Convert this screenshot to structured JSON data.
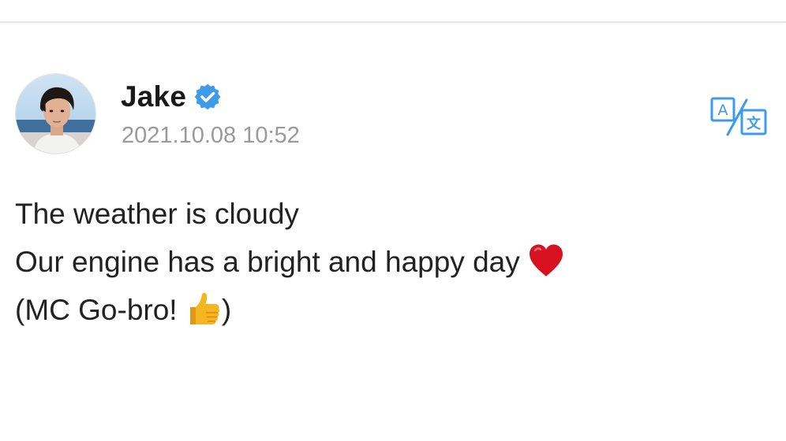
{
  "post": {
    "author_name": "Jake",
    "timestamp": "2021.10.08 10:52",
    "lines": {
      "line1": "The weather is cloudy",
      "line2_text": "Our engine has a bright and happy day",
      "line3_prefix": "(MC Go-bro!",
      "line3_suffix": ")"
    },
    "icons": {
      "verified": "verified-badge-icon",
      "translate": "translate-icon",
      "heart": "red-heart-emoji",
      "thumbs_up": "thumbs-up-emoji"
    }
  },
  "colors": {
    "accent": "#3d9be9",
    "heart": "#d7111f",
    "thumb": "#f5b623",
    "text": "#222222",
    "muted": "#9a9a9a"
  }
}
